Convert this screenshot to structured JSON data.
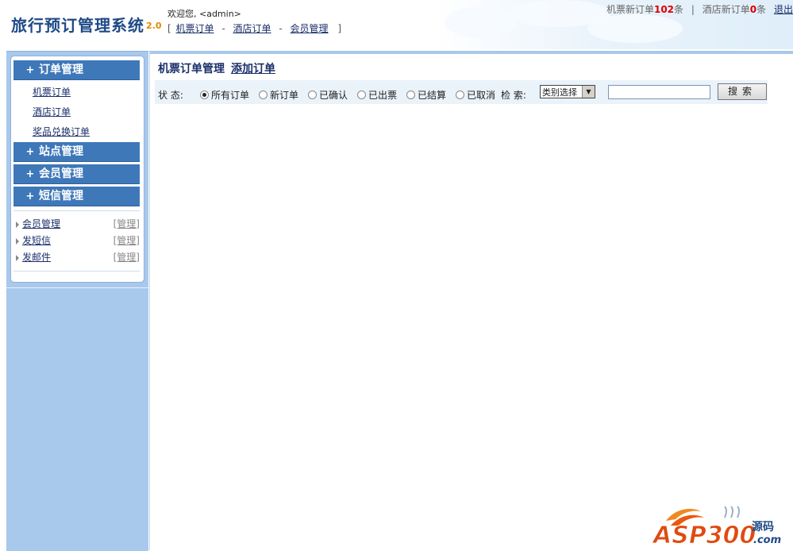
{
  "header": {
    "app_title": "旅行预订管理系统",
    "app_version": "2.0",
    "welcome": "欢迎您, <admin>",
    "nav_open": "[",
    "nav_close": "]",
    "nav_sep": "-",
    "nav": [
      "机票订单",
      "酒店订单",
      "会员管理"
    ],
    "notice_prefix_1": "机票新订单",
    "notice_count_1": "102",
    "notice_unit_1": "条",
    "notice_sep": "|",
    "notice_prefix_2": "酒店新订单",
    "notice_count_2": "0",
    "notice_unit_2": "条",
    "logout": "退出"
  },
  "sidebar": {
    "groups": [
      {
        "label": "订单管理",
        "expanded": true,
        "items": [
          "机票订单",
          "酒店订单",
          "奖品兑换订单"
        ]
      },
      {
        "label": "站点管理"
      },
      {
        "label": "会员管理"
      },
      {
        "label": "短信管理"
      }
    ],
    "plus_icon": "+",
    "member_links": [
      {
        "label": "会员管理",
        "action": "[管理]"
      },
      {
        "label": "发短信",
        "action": "[管理]"
      },
      {
        "label": "发邮件",
        "action": "[管理]"
      }
    ]
  },
  "main": {
    "title": "机票订单管理",
    "add_link": "添加订单",
    "status_label": "状 态:",
    "statuses": [
      "所有订单",
      "新订单",
      "已确认",
      "已出票",
      "已结算",
      "已取消"
    ],
    "selected_status": "所有订单",
    "search_label": "检 索:",
    "category_select": "类别选择",
    "search_value": "",
    "search_button": "搜索"
  },
  "watermark": {
    "text": "ASP300源码",
    "sub": ".com"
  },
  "colors": {
    "brand": "#1f4a86",
    "menu_head": "#3f78b9",
    "sidebar_bg": "#a8c8ec",
    "notice_count": "#dd0000",
    "watermark": "#e04a10"
  }
}
